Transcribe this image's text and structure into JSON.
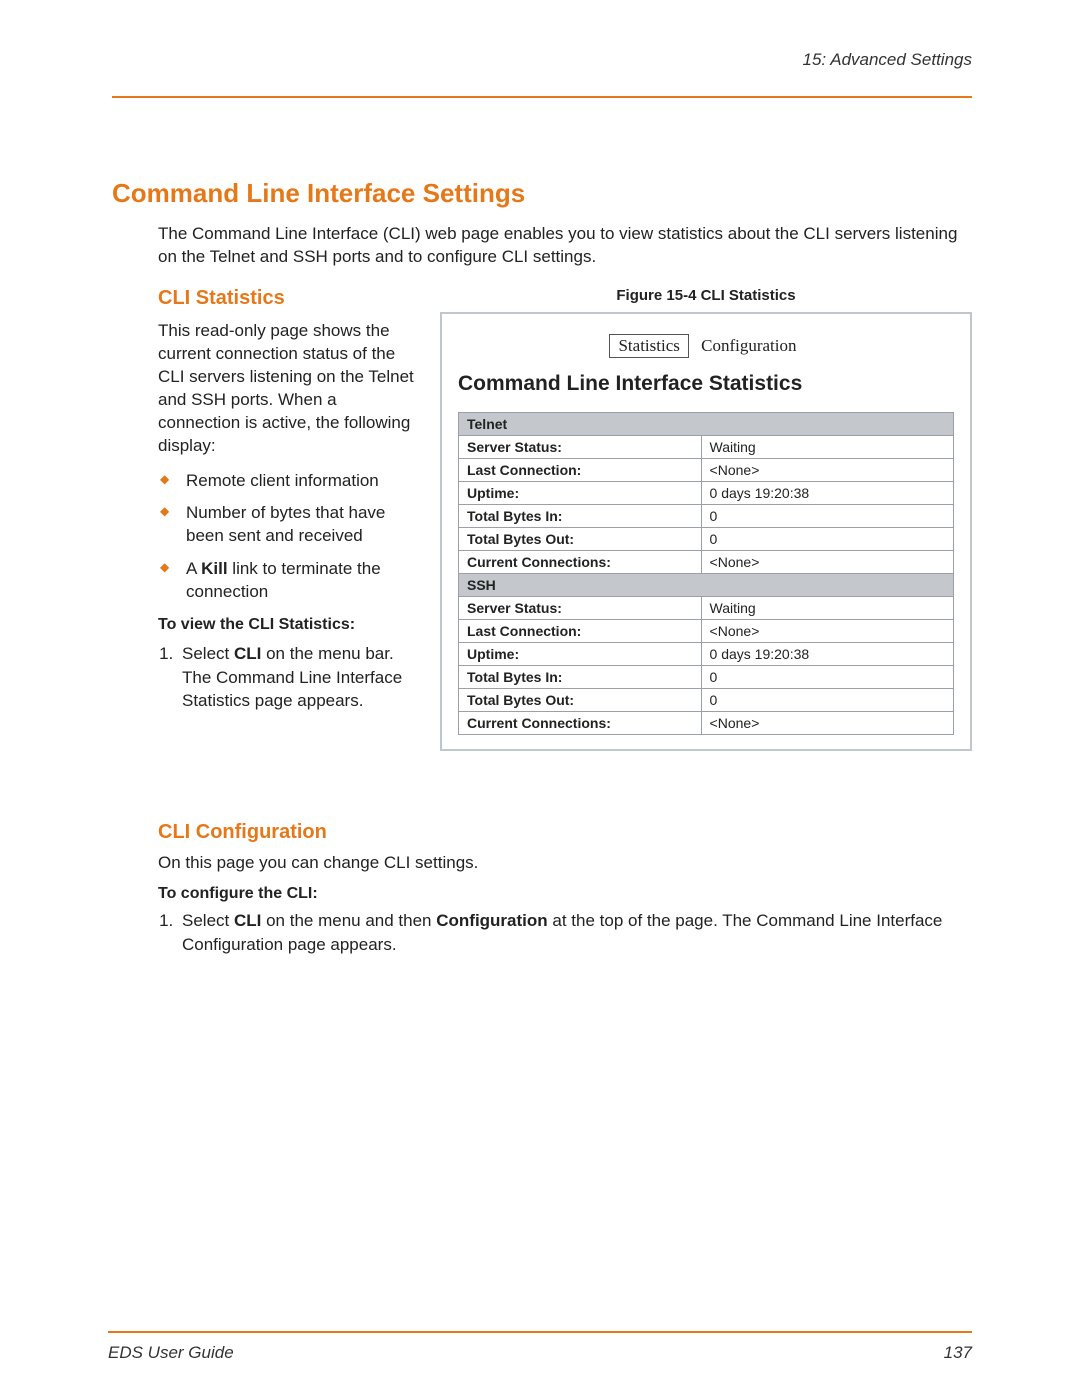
{
  "header": {
    "chapter": "15: Advanced Settings"
  },
  "main": {
    "title": "Command Line Interface Settings",
    "intro": "The Command Line Interface (CLI) web page enables you to view statistics about the CLI servers listening on the Telnet and SSH ports and to configure CLI settings."
  },
  "cli_stats": {
    "heading": "CLI Statistics",
    "desc": "This read-only page shows the current connection status of the CLI servers listening on the Telnet and SSH ports. When a connection is active, the following display:",
    "bullets": {
      "b1": "Remote client information",
      "b2": "Number of bytes that have been sent and received",
      "b3a": "A ",
      "b3b": "Kill",
      "b3c": " link  to terminate the connection"
    },
    "howto_label": "To view the CLI Statistics:",
    "step1_a": "Select ",
    "step1_b": "CLI",
    "step1_c": " on the menu bar. The Command Line Interface Statistics page appears."
  },
  "figure": {
    "caption": "Figure 15-4  CLI Statistics",
    "tabs": {
      "selected": "Statistics",
      "other": "Configuration"
    },
    "title": "Command Line Interface Statistics",
    "sections": {
      "telnet": "Telnet",
      "ssh": "SSH"
    },
    "rows": {
      "server_status": "Server Status:",
      "last_conn": "Last Connection:",
      "uptime": "Uptime:",
      "bytes_in": "Total Bytes In:",
      "bytes_out": "Total Bytes Out:",
      "curr_conn": "Current Connections:"
    },
    "telnet": {
      "server_status": "Waiting",
      "last_conn": "<None>",
      "uptime": "0 days 19:20:38",
      "bytes_in": "0",
      "bytes_out": "0",
      "curr_conn": "<None>"
    },
    "ssh": {
      "server_status": "Waiting",
      "last_conn": "<None>",
      "uptime": "0 days 19:20:38",
      "bytes_in": "0",
      "bytes_out": "0",
      "curr_conn": "<None>"
    }
  },
  "cli_config": {
    "heading": "CLI Configuration",
    "desc": "On this page you can change CLI settings.",
    "howto_label": "To configure the CLI:",
    "step1_a": "Select ",
    "step1_b": "CLI",
    "step1_c": " on the menu and then ",
    "step1_d": "Configuration",
    "step1_e": " at the top of the page. The Command Line Interface Configuration page appears."
  },
  "footer": {
    "guide": "EDS User Guide",
    "page": "137"
  }
}
